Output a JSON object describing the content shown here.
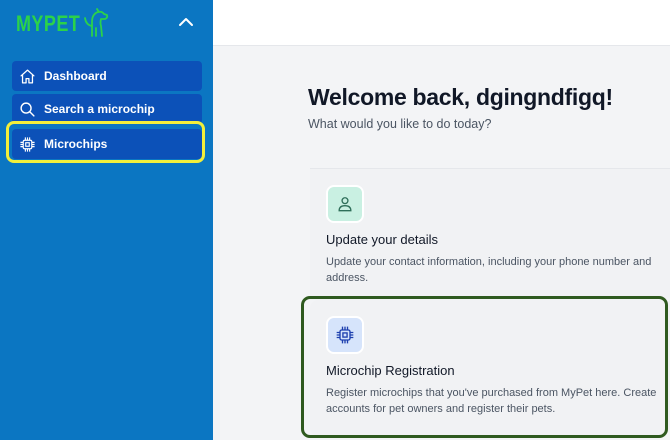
{
  "brand": {
    "name": "MYPET"
  },
  "sidebar": {
    "collapse_icon": "chevron-up-icon",
    "items": [
      {
        "label": "Dashboard",
        "icon": "home-icon"
      },
      {
        "label": "Search a microchip",
        "icon": "search-icon"
      },
      {
        "label": "Microchips",
        "icon": "chip-icon",
        "active": true
      }
    ]
  },
  "main": {
    "welcome": "Welcome back, dgingndfigq!",
    "subtitle": "What would you like to do today?",
    "cards": [
      {
        "title": "Update your details",
        "description": "Update your contact information, including your phone number and address.",
        "icon": "user-icon"
      },
      {
        "title": "Microchip Registration",
        "description": "Register microchips that you've purchased from MyPet here. Create accounts for pet owners and register their pets.",
        "icon": "chip-icon"
      }
    ]
  },
  "colors": {
    "sidebar_bg": "#0b76c2",
    "nav_item_bg": "#0c51b8",
    "brand_green": "#2bd24a",
    "highlight_yellow": "#f2ef3a",
    "card_frame_green": "#2f5a1f"
  }
}
